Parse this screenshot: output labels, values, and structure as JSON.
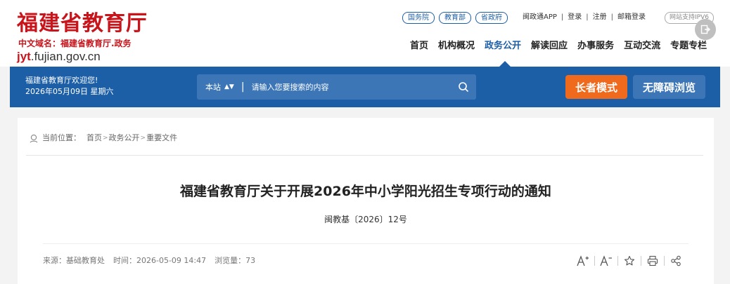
{
  "header": {
    "logo_title": "福建省教育厅",
    "domain_label": "中文域名：福建省教育厅.政务",
    "url_prefix": "jyt",
    "url_suffix": ".fujian.gov.cn",
    "gov_links": [
      "国务院",
      "教育部",
      "省政府"
    ],
    "top_links": [
      "闽政通APP",
      "登录",
      "注册",
      "邮箱登录"
    ],
    "ipv6": "网站支持IPV6",
    "nav": [
      "首页",
      "机构概况",
      "政务公开",
      "解读回应",
      "办事服务",
      "互动交流",
      "专题专栏"
    ],
    "nav_active": "政务公开"
  },
  "bluebar": {
    "welcome": "福建省教育厅欢迎您!",
    "date": "2026年05月09日 星期六",
    "search_scope": "本站",
    "search_placeholder": "请输入您要搜索的内容",
    "elder_mode": "长者模式",
    "accessibility": "无障碍浏览",
    "colors": {
      "bar": "#1d5fa7",
      "elder": "#f06a1e"
    }
  },
  "article": {
    "breadcrumb_label": "当前位置：",
    "breadcrumb": [
      "首页",
      "政务公开",
      "重要文件"
    ],
    "title": "福建省教育厅关于开展2026年中小学阳光招生专项行动的通知",
    "doc_number": "闽教基〔2026〕12号",
    "source": "来源：基础教育处",
    "time": "时间：2026-05-09 14:47",
    "views": "浏览量：73"
  },
  "icons": [
    "location-icon",
    "search-icon",
    "font-larger-icon",
    "font-smaller-icon",
    "star-icon",
    "print-icon",
    "share-icon",
    "exit-icon"
  ]
}
